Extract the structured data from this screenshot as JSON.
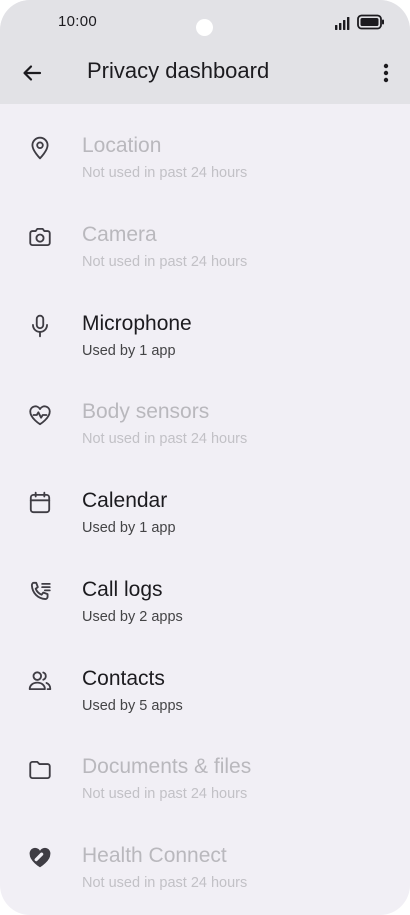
{
  "status_bar": {
    "time": "10:00"
  },
  "app_bar": {
    "title": "Privacy dashboard",
    "back_icon": "arrow-back-icon",
    "menu_icon": "more-vert-icon"
  },
  "permissions": [
    {
      "label": "Location",
      "subtitle": "Not used in past 24 hours",
      "icon": "location-pin-icon",
      "enabled": false
    },
    {
      "label": "Camera",
      "subtitle": "Not used in past 24 hours",
      "icon": "camera-icon",
      "enabled": false
    },
    {
      "label": "Microphone",
      "subtitle": "Used by 1 app",
      "icon": "microphone-icon",
      "enabled": true
    },
    {
      "label": "Body sensors",
      "subtitle": "Not used in past 24 hours",
      "icon": "heart-pulse-icon",
      "enabled": false
    },
    {
      "label": "Calendar",
      "subtitle": "Used by 1 app",
      "icon": "calendar-icon",
      "enabled": true
    },
    {
      "label": "Call logs",
      "subtitle": "Used by 2 apps",
      "icon": "call-log-icon",
      "enabled": true
    },
    {
      "label": "Contacts",
      "subtitle": "Used by 5 apps",
      "icon": "contacts-icon",
      "enabled": true
    },
    {
      "label": "Documents & files",
      "subtitle": "Not used in past 24 hours",
      "icon": "folder-icon",
      "enabled": false
    },
    {
      "label": "Health Connect",
      "subtitle": "Not used in past 24 hours",
      "icon": "health-connect-icon",
      "enabled": false
    }
  ]
}
